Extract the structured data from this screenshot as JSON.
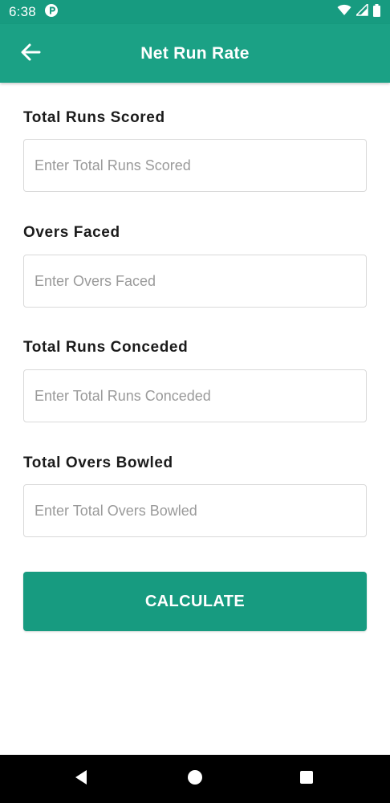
{
  "status_bar": {
    "time": "6:38",
    "notification_icon": "app-notification-icon",
    "icons": [
      "wifi-icon",
      "signal-icon",
      "battery-icon"
    ]
  },
  "app_bar": {
    "title": "Net Run Rate",
    "back_icon": "arrow-left-icon"
  },
  "form": {
    "fields": [
      {
        "label": "Total Runs Scored",
        "placeholder": "Enter Total Runs Scored",
        "value": ""
      },
      {
        "label": "Overs Faced",
        "placeholder": "Enter Overs Faced",
        "value": ""
      },
      {
        "label": "Total Runs Conceded",
        "placeholder": "Enter Total Runs Conceded",
        "value": ""
      },
      {
        "label": "Total Overs Bowled",
        "placeholder": "Enter Total Overs Bowled",
        "value": ""
      }
    ],
    "calculate_label": "CALCULATE"
  },
  "nav_bar": {
    "icons": [
      "back-triangle-icon",
      "home-circle-icon",
      "recents-square-icon"
    ]
  },
  "colors": {
    "primary": "#1ba185",
    "primary_dark": "#179b80",
    "label_text": "#1b1b1b",
    "placeholder_text": "#9a9a9a",
    "input_border": "#d9d9d9"
  }
}
